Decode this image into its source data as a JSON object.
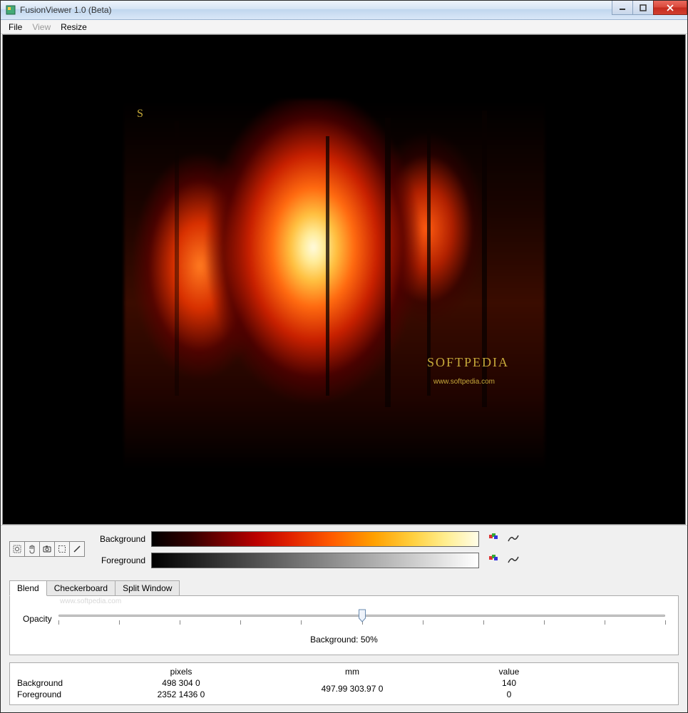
{
  "window": {
    "title": "FusionViewer 1.0 (Beta)"
  },
  "menu": {
    "file": "File",
    "view": "View",
    "resize": "Resize"
  },
  "image_overlay": {
    "corner": "S",
    "brand": "SOFTPEDIA",
    "url": "www.softpedia.com"
  },
  "gradients": {
    "background_label": "Background",
    "foreground_label": "Foreground"
  },
  "tabs": {
    "blend": "Blend",
    "checkerboard": "Checkerboard",
    "split": "Split Window"
  },
  "blend_panel": {
    "watermark": "www.softpedia.com",
    "opacity_label": "Opacity",
    "slider_value_percent": 50,
    "caption": "Background: 50%"
  },
  "info_table": {
    "headers": {
      "pixels": "pixels",
      "mm": "mm",
      "value": "value"
    },
    "rows": [
      {
        "label": "Background",
        "pixels": "498 304 0",
        "mm": "497.99 303.97 0",
        "value": "140"
      },
      {
        "label": "Foreground",
        "pixels": "2352 1436 0",
        "mm": "",
        "value": "0"
      }
    ]
  }
}
